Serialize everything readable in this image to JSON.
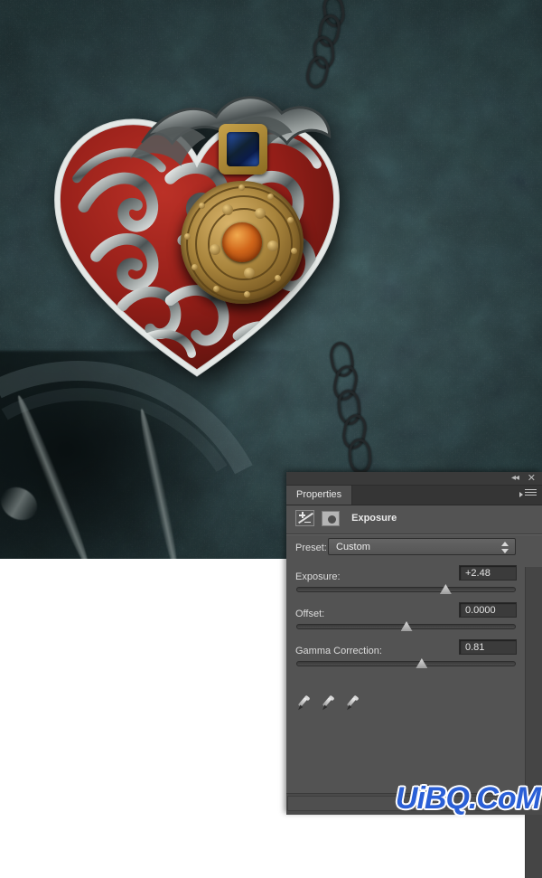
{
  "app": {
    "panel_title": "Properties",
    "adjustment_name": "Exposure"
  },
  "titlebar": {
    "collapse_label": "◂◂",
    "close_label": "✕"
  },
  "icons": {
    "exposure_adjustment": "exposure-icon",
    "layer_mask": "mask-icon",
    "panel_menu": "hamburger-menu-icon",
    "eyedropper_black": "eyedropper-black-point-icon",
    "eyedropper_gray": "eyedropper-gray-point-icon",
    "eyedropper_white": "eyedropper-white-point-icon",
    "reset": "reset-icon",
    "visibility": "eye-icon",
    "clip_to_layer": "clip-to-layer-icon",
    "delete": "trash-icon"
  },
  "preset": {
    "label": "Preset:",
    "value": "Custom"
  },
  "controls": [
    {
      "label": "Exposure:",
      "value": "+2.48",
      "slider_percent": 68
    },
    {
      "label": "Offset:",
      "value": "0.0000",
      "slider_percent": 50
    },
    {
      "label": "Gamma Correction:",
      "value": "0.81",
      "slider_percent": 57
    }
  ],
  "colors": {
    "panel_bg": "#535353",
    "panel_tabbar": "#353535",
    "panel_titlebar": "#3a3a3a",
    "tab_active": "#4e4e4e",
    "field_bg": "#3b3b3b",
    "text": "#dcdcdc",
    "watermark_blue": "#2a5fd6",
    "photo_bg_teal": "#2b3e41",
    "pendant_red": "#8f1d17",
    "pendant_silver": "#c9cece",
    "pendant_gold": "#a8843c",
    "gem_blue": "#123b8a",
    "gem_amber": "#d0651a"
  },
  "watermark": {
    "text": "UiBQ.CoM"
  },
  "photo": {
    "subject": "ornate silver and red filigree heart pendant on chain",
    "background": "dark teal grunge texture"
  }
}
